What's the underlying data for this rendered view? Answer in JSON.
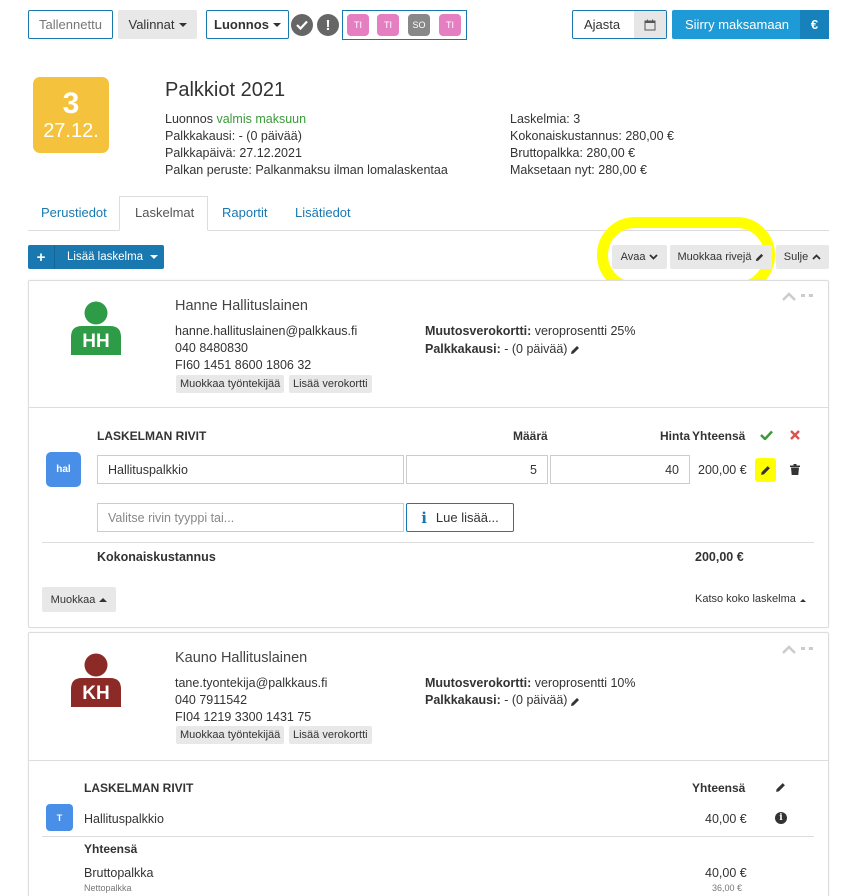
{
  "toolbar": {
    "saved": "Tallennettu",
    "options": "Valinnat",
    "draft": "Luonnos",
    "chips": [
      {
        "label": "TI",
        "color": "#e57fc2"
      },
      {
        "label": "TI",
        "color": "#e57fc2"
      },
      {
        "label": "SO",
        "color": "#888888"
      },
      {
        "label": "TI",
        "color": "#e57fc2"
      }
    ],
    "schedule": "Ajasta",
    "pay": "Siirry maksamaan",
    "currency_symbol": "€"
  },
  "date_badge": {
    "number": "3",
    "date": "27.12.",
    "color": "#f5c23e"
  },
  "header": {
    "title": "Palkkiot 2021",
    "status_prefix": "Luonnos",
    "status_ready": "valmis maksuun",
    "period": "Palkkakausi: - (0 päivää)",
    "payday": "Palkkapäivä: 27.12.2021",
    "basis": "Palkan peruste: Palkanmaksu ilman lomalaskentaa",
    "calc_count": "Laskelmia: 3",
    "total_cost": "Kokonaiskustannus: 280,00 €",
    "gross": "Bruttopalkka: 280,00 €",
    "pay_now": "Maksetaan nyt: 280,00 €"
  },
  "tabs": [
    "Perustiedot",
    "Laskelmat",
    "Raportit",
    "Lisätiedot"
  ],
  "actions": {
    "add_calc": "Lisää laskelma",
    "open": "Avaa",
    "edit_rows": "Muokkaa rivejä",
    "close": "Sulje"
  },
  "employees": [
    {
      "initials": "HH",
      "avatar_color": "#2e9b47",
      "name": "Hanne Hallituslainen",
      "email": "hanne.hallituslainen@palkkaus.fi",
      "phone": "040 8480830",
      "iban": "FI60 1451 8600 1806 32",
      "edit_employee": "Muokkaa työntekijää",
      "add_tax_card": "Lisää verokortti",
      "tax_card_label": "Muutosverokortti:",
      "tax_card_value": "veroprosentti 25%",
      "period_label": "Palkkakausi:",
      "period_value": "- (0 päivää)"
    },
    {
      "initials": "KH",
      "avatar_color": "#8b2a26",
      "name": "Kauno Hallituslainen",
      "email": "tane.tyontekija@palkkaus.fi",
      "phone": "040 7911542",
      "iban": "FI04 1219 3300 1431 75",
      "edit_employee": "Muokkaa työntekijää",
      "add_tax_card": "Lisää verokortti",
      "tax_card_label": "Muutosverokortti:",
      "tax_card_value": "veroprosentti 10%",
      "period_label": "Palkkakausi:",
      "period_value": "- (0 päivää)"
    }
  ],
  "calc1": {
    "rows_header": "LASKELMAN RIVIT",
    "qty_header": "Määrä",
    "price_header": "Hinta",
    "total_header": "Yhteensä",
    "row_badge": "hal",
    "row_name": "Hallituspalkkio",
    "row_qty": "5",
    "row_price": "40",
    "row_total": "200,00 €",
    "type_placeholder": "Valitse rivin tyyppi tai...",
    "read_more": "Lue lisää...",
    "total_cost_label": "Kokonaiskustannus",
    "total_cost_value": "200,00 €",
    "edit": "Muokkaa",
    "view_full": "Katso koko laskelma"
  },
  "calc2": {
    "rows_header": "LASKELMAN RIVIT",
    "total_header": "Yhteensä",
    "row_badge": "T",
    "row_name": "Hallituspalkkio",
    "row_total": "40,00 €",
    "sum_header": "Yhteensä",
    "gross_label": "Bruttopalkka",
    "gross_value": "40,00 €",
    "net_label": "Nettopalkka",
    "net_value": "36,00 €"
  },
  "colors": {
    "primary": "#1a78b0",
    "pay_button": "#1e9ad6",
    "highlight": "#ffff00",
    "confirm": "#3a9a3a",
    "cancel": "#d9534f"
  }
}
